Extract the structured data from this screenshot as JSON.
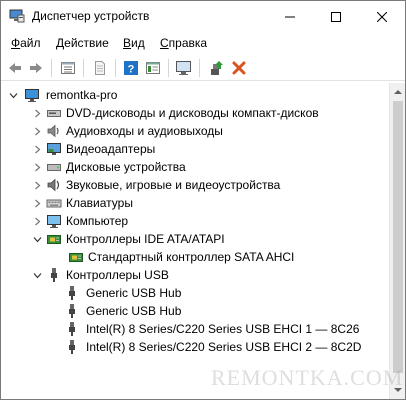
{
  "window": {
    "title": "Диспетчер устройств",
    "min_icon": "minimize-icon",
    "max_icon": "maximize-icon",
    "close_icon": "close-icon"
  },
  "menu": [
    {
      "label_u": "Ф",
      "label_rest": "айл"
    },
    {
      "label_u": "Д",
      "label_rest": "ействие"
    },
    {
      "label_u": "В",
      "label_rest": "ид"
    },
    {
      "label_u": "С",
      "label_rest": "правка"
    }
  ],
  "toolbar": {
    "icons": [
      "back-arrow-icon",
      "forward-arrow-icon",
      "properties-grid-icon",
      "document-icon",
      "help-icon",
      "view-resources-icon",
      "monitor-scan-icon",
      "update-driver-icon",
      "uninstall-x-icon"
    ]
  },
  "tree": {
    "root": "remontka-pro",
    "items": [
      {
        "label": "DVD-дисководы и дисководы компакт-дисков",
        "icon": "dvd-drive-icon",
        "expanded": false,
        "level": 1
      },
      {
        "label": "Аудиовходы и аудиовыходы",
        "icon": "audio-io-icon",
        "expanded": false,
        "level": 1
      },
      {
        "label": "Видеоадаптеры",
        "icon": "display-adapter-icon",
        "expanded": false,
        "level": 1
      },
      {
        "label": "Дисковые устройства",
        "icon": "disk-drive-icon",
        "expanded": false,
        "level": 1
      },
      {
        "label": "Звуковые, игровые и видеоустройства",
        "icon": "sound-device-icon",
        "expanded": false,
        "level": 1
      },
      {
        "label": "Клавиатуры",
        "icon": "keyboard-icon",
        "expanded": false,
        "level": 1
      },
      {
        "label": "Компьютер",
        "icon": "computer-icon",
        "expanded": false,
        "level": 1
      },
      {
        "label": "Контроллеры IDE ATA/ATAPI",
        "icon": "ide-controller-icon",
        "expanded": true,
        "level": 1
      },
      {
        "label": "Стандартный контроллер SATA AHCI",
        "icon": "ide-controller-icon",
        "expanded": null,
        "level": 2
      },
      {
        "label": "Контроллеры USB",
        "icon": "usb-plug-icon",
        "expanded": true,
        "level": 1
      },
      {
        "label": "Generic USB Hub",
        "icon": "usb-plug-icon",
        "expanded": null,
        "level": 2
      },
      {
        "label": "Generic USB Hub",
        "icon": "usb-plug-icon",
        "expanded": null,
        "level": 2
      },
      {
        "label": "Intel(R) 8 Series/C220 Series USB EHCI 1 — 8C26",
        "icon": "usb-plug-icon",
        "expanded": null,
        "level": 2
      },
      {
        "label": "Intel(R) 8 Series/C220 Series USB EHCI 2 — 8C2D",
        "icon": "usb-plug-icon",
        "expanded": null,
        "level": 2
      }
    ]
  },
  "watermark": "REMONTKA.COM",
  "colors": {
    "accent_blue": "#1e73c8",
    "uninstall_red": "#d9541e",
    "update_green": "#2f9a3a"
  }
}
